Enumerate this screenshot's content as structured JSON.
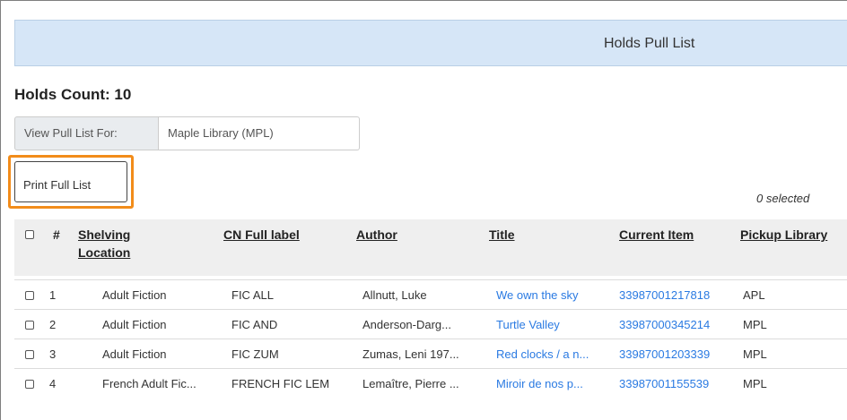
{
  "header": {
    "title": "Holds Pull List"
  },
  "summary": {
    "holds_count_label": "Holds Count: 10"
  },
  "pull_list": {
    "label": "View Pull List For:",
    "value": "Maple Library (MPL)"
  },
  "actions": {
    "print_label": "Print Full List"
  },
  "selection": {
    "selected_text": "0 selected"
  },
  "table": {
    "columns": {
      "num": "#",
      "shelving": "Shelving",
      "shelving2": "Location",
      "cn": "CN Full label",
      "author": "Author",
      "title": "Title",
      "current_item": "Current Item",
      "pickup": "Pickup Library"
    },
    "rows": [
      {
        "num": "1",
        "shelving": "Adult Fiction",
        "cn": "FIC ALL",
        "author": "Allnutt, Luke",
        "title": "We own the sky",
        "item": "33987001217818",
        "pickup": "APL"
      },
      {
        "num": "2",
        "shelving": "Adult Fiction",
        "cn": "FIC AND",
        "author": "Anderson-Darg...",
        "title": "Turtle Valley",
        "item": "33987000345214",
        "pickup": "MPL"
      },
      {
        "num": "3",
        "shelving": "Adult Fiction",
        "cn": "FIC ZUM",
        "author": "Zumas, Leni 197...",
        "title": "Red clocks / a n...",
        "item": "33987001203339",
        "pickup": "MPL"
      },
      {
        "num": "4",
        "shelving": "French Adult Fic...",
        "cn": "FRENCH FIC LEM",
        "author": "Lemaître, Pierre ...",
        "title": "Miroir de nos p...",
        "item": "33987001155539",
        "pickup": "MPL"
      }
    ]
  }
}
